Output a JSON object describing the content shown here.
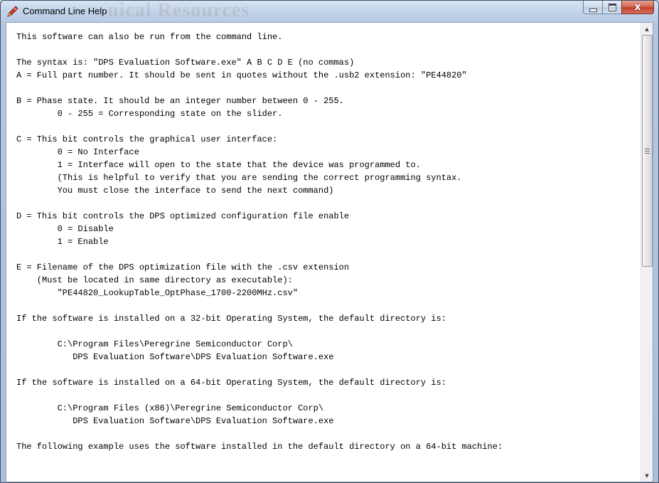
{
  "window": {
    "title": "Command Line Help",
    "title_watermark": "nical Resources",
    "close_glyph": "x",
    "app_icon": "pen-icon",
    "accent_colors": {
      "close_button": "#c2402a",
      "titlebar": "#c2d4e9"
    }
  },
  "help_text": {
    "lines": [
      "This software can also be run from the command line.",
      "",
      "The syntax is: \"DPS Evaluation Software.exe\" A B C D E (no commas)",
      "A = Full part number. It should be sent in quotes without the .usb2 extension: \"PE44820\"",
      "",
      "B = Phase state. It should be an integer number between 0 - 255.",
      "        0 - 255 = Corresponding state on the slider.",
      "",
      "C = This bit controls the graphical user interface:",
      "        0 = No Interface",
      "        1 = Interface will open to the state that the device was programmed to.",
      "        (This is helpful to verify that you are sending the correct programming syntax.",
      "        You must close the interface to send the next command)",
      "",
      "D = This bit controls the DPS optimized configuration file enable",
      "        0 = Disable",
      "        1 = Enable",
      "",
      "E = Filename of the DPS optimization file with the .csv extension",
      "    (Must be located in same directory as executable):",
      "        \"PE44820_LookupTable_OptPhase_1700-2200MHz.csv\"",
      "",
      "If the software is installed on a 32-bit Operating System, the default directory is:",
      "",
      "        C:\\Program Files\\Peregrine Semiconductor Corp\\",
      "           DPS Evaluation Software\\DPS Evaluation Software.exe",
      "",
      "If the software is installed on a 64-bit Operating System, the default directory is:",
      "",
      "        C:\\Program Files (x86)\\Peregrine Semiconductor Corp\\",
      "           DPS Evaluation Software\\DPS Evaluation Software.exe",
      "",
      "The following example uses the software installed in the default directory on a 64-bit machine:"
    ]
  },
  "scrollbar": {
    "up_arrow": "▲",
    "down_arrow": "▼",
    "position_fraction": 0.0,
    "visible_fraction": 0.53
  }
}
